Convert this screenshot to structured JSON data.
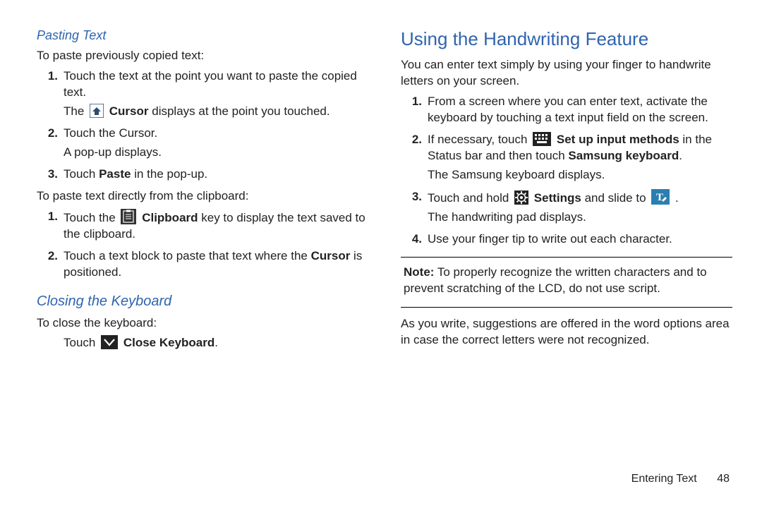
{
  "left": {
    "pasting_title": "Pasting Text",
    "pasting_intro": "To paste previously copied text:",
    "p1_a": "Touch the text at the point you want to paste the copied text.",
    "p1_b_pre": "The ",
    "p1_b_mid": "Cursor",
    "p1_b_post": " displays at the point you touched.",
    "p2_a": "Touch the Cursor.",
    "p2_b": "A pop-up displays.",
    "p3_pre": "Touch ",
    "p3_bold": "Paste",
    "p3_post": " in the pop-up.",
    "clip_intro": "To paste text directly from the clipboard:",
    "c1_a_pre": "Touch the ",
    "c1_a_mid": "Clipboard",
    "c1_a_post": " key to display the text saved to the clipboard.",
    "c2_pre": "Touch a text block to paste that text where the ",
    "c2_bold": "Cursor",
    "c2_post": " is positioned.",
    "closing_title": "Closing the Keyboard",
    "closing_intro": "To close the keyboard:",
    "close_pre": "Touch ",
    "close_bold": "Close Keyboard",
    "close_post": "."
  },
  "right": {
    "hw_title": "Using the Handwriting Feature",
    "hw_intro": "You can enter text simply by using your finger to handwrite letters on your screen.",
    "h1": "From a screen where you can enter text, activate the keyboard by touching a text input field on the screen.",
    "h2_pre": "If necessary, touch ",
    "h2_b1": "Set up input methods",
    "h2_mid": " in the Status bar and then touch ",
    "h2_b2": "Samsung keyboard",
    "h2_post": ".",
    "h2_sub": "The Samsung keyboard displays.",
    "h3_pre": "Touch and hold ",
    "h3_b1": "Settings",
    "h3_mid": " and slide to ",
    "h3_post": ".",
    "h3_sub": "The handwriting pad displays.",
    "h4": "Use your finger tip to write out each character.",
    "note_label": "Note:",
    "note_text": " To properly recognize the written characters and to prevent scratching of the LCD, do not use script.",
    "suggest": "As you write, suggestions are offered in the word options area in case the correct letters were not recognized."
  },
  "footer": {
    "section": "Entering Text",
    "page": "48"
  }
}
